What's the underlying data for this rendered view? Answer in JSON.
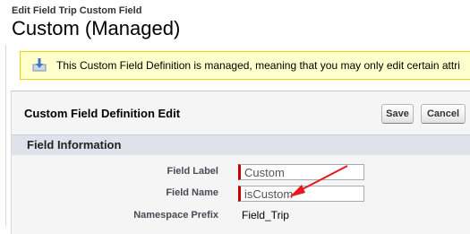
{
  "header": {
    "subtitle": "Edit Field Trip Custom Field",
    "title": "Custom (Managed)"
  },
  "info": {
    "message": "This Custom Field Definition is managed, meaning that you may only edit certain attri"
  },
  "panel": {
    "title": "Custom Field Definition Edit",
    "save_label": "Save",
    "cancel_label": "Cancel",
    "section_title": "Field Information",
    "fields": [
      {
        "label": "Field Label",
        "value": "Custom"
      },
      {
        "label": "Field Name",
        "value": "isCustom"
      },
      {
        "label": "Namespace Prefix",
        "value": "Field_Trip"
      }
    ]
  },
  "colors": {
    "info_bg": "#ffffcc",
    "required_bar": "#cc0000",
    "annotation_arrow": "#e8181e",
    "section_bar": "#dfe2e8"
  }
}
